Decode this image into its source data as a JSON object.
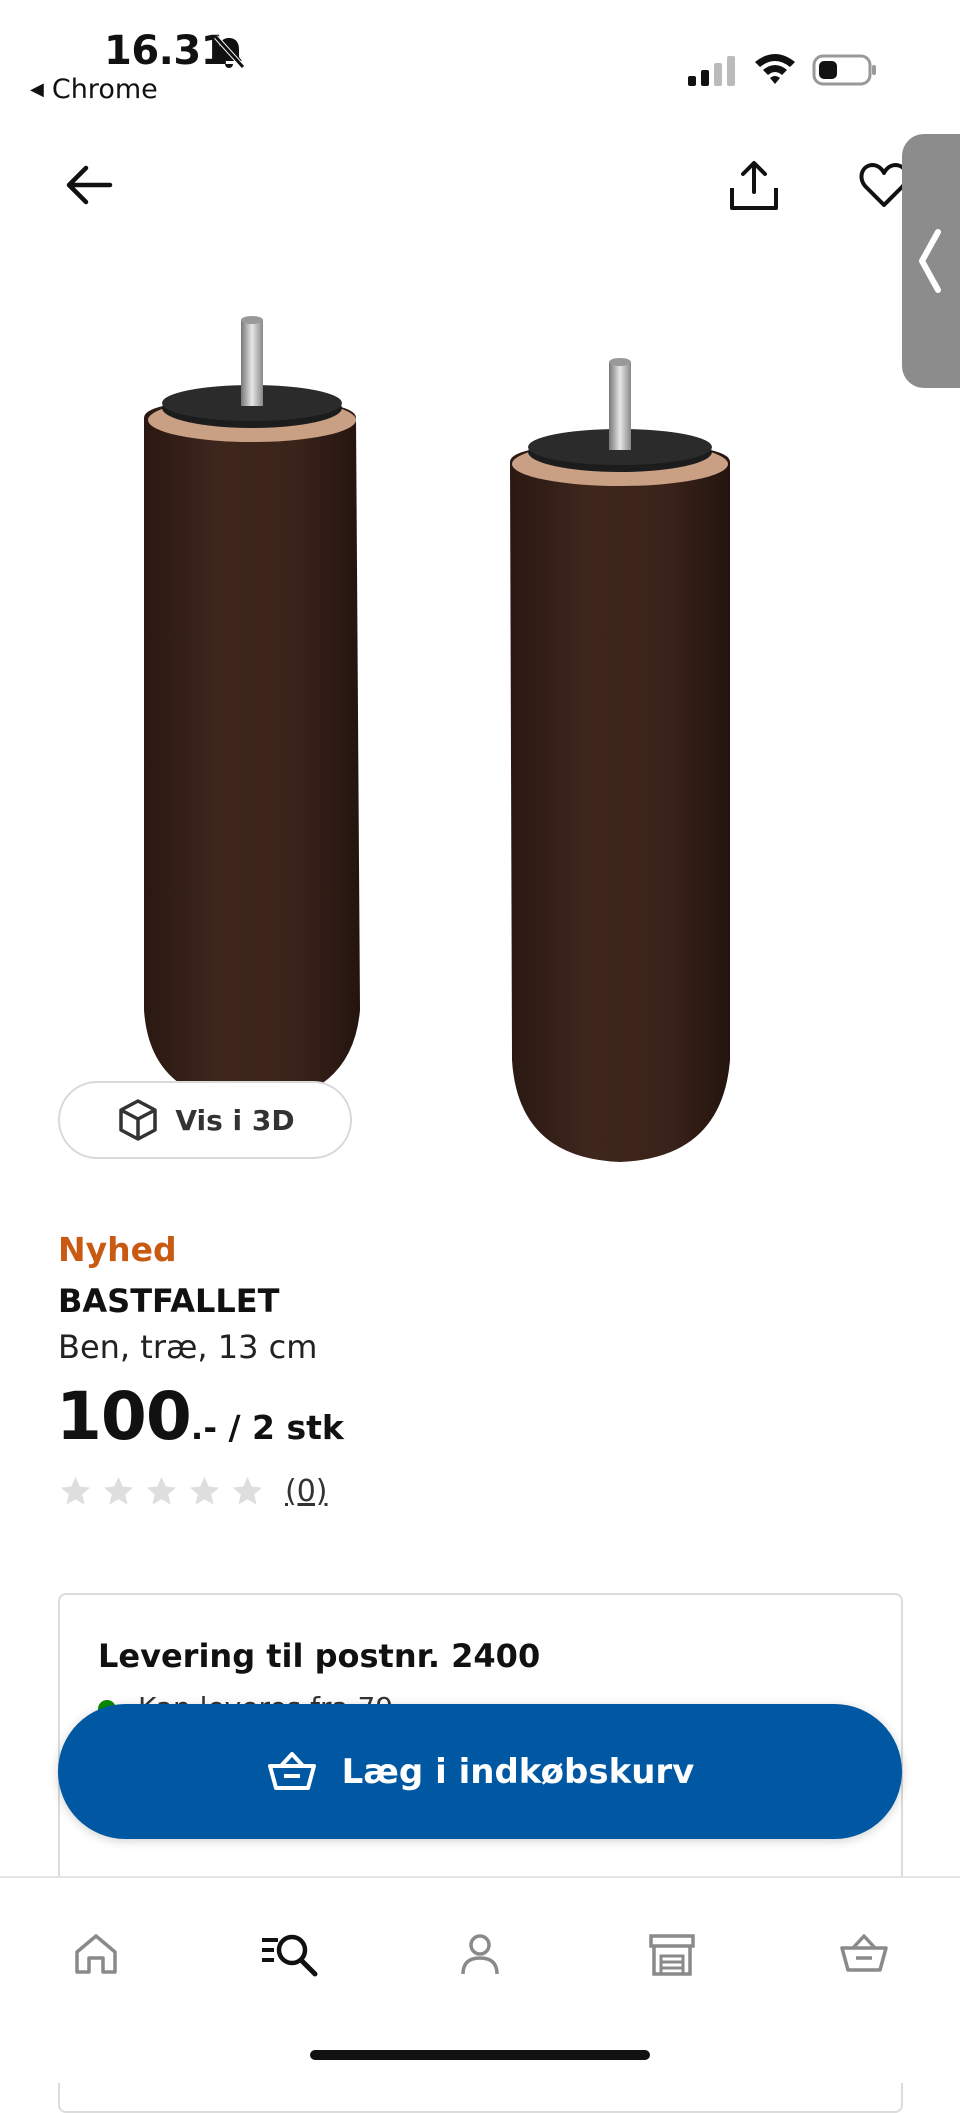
{
  "status_bar": {
    "time": "16.31",
    "back_app": "Chrome"
  },
  "product": {
    "badge": "Nyhed",
    "name": "BASTFALLET",
    "description": "Ben, træ, 13 cm",
    "price_main": "100",
    "price_suffix": ".- / 2 stk",
    "rating": {
      "value": 0,
      "max": 5,
      "count_label": "(0)"
    },
    "view_3d_label": "Vis i 3D"
  },
  "delivery": {
    "title": "Levering til postnr. 2400",
    "line": "Kan leveres fra 79,-"
  },
  "cart": {
    "button_label": "Læg i indkøbskurv"
  },
  "colors": {
    "accent_blue": "#0058a3",
    "badge_orange": "#c85a11",
    "stock_green": "#0a8a00",
    "wood_dark": "#3a231b"
  },
  "tabbar": {
    "items": [
      "home-icon",
      "search-icon",
      "profile-icon",
      "store-icon",
      "basket-icon"
    ],
    "active": "search-icon"
  }
}
